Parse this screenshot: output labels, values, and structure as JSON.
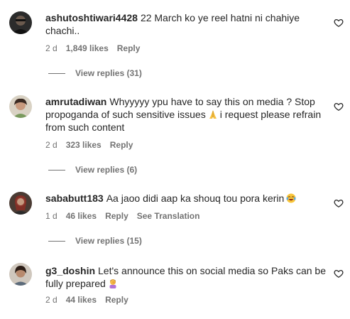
{
  "comments": [
    {
      "username": "ashutoshtiwari4428",
      "text": "22 March ko ye reel hatni ni chahiye chachi..",
      "time": "2 d",
      "likes": "1,849 likes",
      "reply_label": "Reply",
      "view_replies": "View replies (31)"
    },
    {
      "username": "amrutadiwan",
      "text": "Whyyyyy ypu have to say this on media ? Stop propoganda of such sensitive issues",
      "text_after_emoji": "i request please refrain from such content",
      "time": "2 d",
      "likes": "323 likes",
      "reply_label": "Reply",
      "view_replies": "View replies (6)"
    },
    {
      "username": "sababutt183",
      "text": "Aa jaoo didi aap ka shouq tou pora kerin",
      "time": "1 d",
      "likes": "46 likes",
      "reply_label": "Reply",
      "see_translation": "See Translation",
      "view_replies": "View replies (15)"
    },
    {
      "username": "g3_doshin",
      "text": "Let's announce this on social media so Paks can be fully prepared",
      "time": "2 d",
      "likes": "44 likes",
      "reply_label": "Reply"
    }
  ],
  "icons": {
    "like": "heart-outline-icon",
    "pray": "folded-hands-emoji",
    "laugh": "tears-of-joy-emoji",
    "facepalm": "facepalm-emoji"
  },
  "colors": {
    "text": "#262626",
    "secondary": "#737373"
  }
}
